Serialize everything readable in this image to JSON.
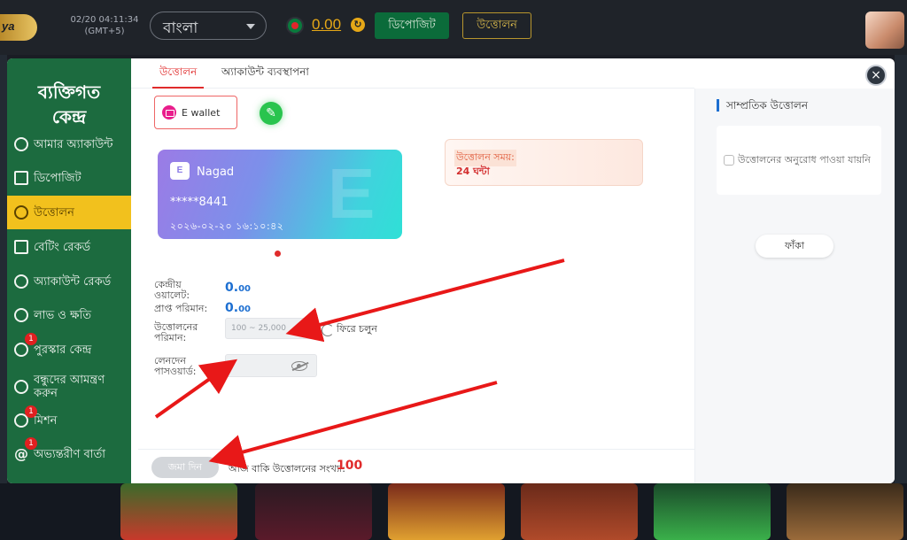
{
  "header": {
    "clock_time": "02/20 04:11:34",
    "clock_tz": "(GMT+5)",
    "language": "বাংলা",
    "balance": "0.00",
    "deposit_label": "ডিপোজিট",
    "withdraw_label": "উত্তোলন",
    "logo_text": "ya"
  },
  "sidebar": {
    "title_line1": "ব্যক্তিগত",
    "title_line2": "কেন্দ্র",
    "items": [
      {
        "label": "আমার অ্যাকাউন্ট"
      },
      {
        "label": "ডিপোজিট"
      },
      {
        "label": "উত্তোলন",
        "active": true
      },
      {
        "label": "বেটিং রেকর্ড"
      },
      {
        "label": "অ্যাকাউন্ট রেকর্ড"
      },
      {
        "label": "লাভ ও ক্ষতি"
      },
      {
        "label": "পুরস্কার কেন্দ্র",
        "badge": "1"
      },
      {
        "label": "বন্ধুদের আমন্ত্রণ করুন"
      },
      {
        "label": "মিশন",
        "badge": "1"
      },
      {
        "label": "অভ্যন্তরীণ বার্তা",
        "badge": "1"
      }
    ]
  },
  "tabs": {
    "withdraw": "উত্তোলন",
    "account_management": "অ্যাকাউন্ট ব্যবস্থাপনা"
  },
  "wallet": {
    "method_label": "E wallet",
    "card_name": "Nagad",
    "card_number": "*****8441",
    "card_date": "২০২৬-০২-২০ ১৬:১০:৪২",
    "card_icon_text": "E"
  },
  "withdraw_time": {
    "label": "উত্তোলন সময়:",
    "value": "24 ঘন্টা"
  },
  "form": {
    "central_wallet_label": "কেন্দ্রীয় ওয়ালেট:",
    "central_wallet_value": "0.",
    "central_wallet_decimals": "00",
    "received_label": "প্রাপ্ত পরিমান:",
    "received_value": "0.",
    "received_decimals": "00",
    "amount_label": "উত্তোলনের পরিমান:",
    "amount_placeholder": "100 ~ 25,000",
    "return_label": "ফিরে চলুন",
    "password_label": "লেনদেন পাসওয়ার্ড:",
    "submit_label": "জমা দিন",
    "remaining_label": "আজ বাকি উত্তোলনের সংখ্যা:",
    "remaining_value": "100"
  },
  "recent": {
    "title": "সাম্প্রতিক উত্তোলন",
    "empty_text": "উত্তোলনের অনুরোধ পাওয়া যায়নি",
    "empty_button": "ফাঁকা"
  },
  "colors": {
    "sidebar_bg": "#1c6b3f",
    "active_item": "#f2c11d",
    "accent_red": "#e02b2b",
    "value_blue": "#1d6fd1"
  }
}
